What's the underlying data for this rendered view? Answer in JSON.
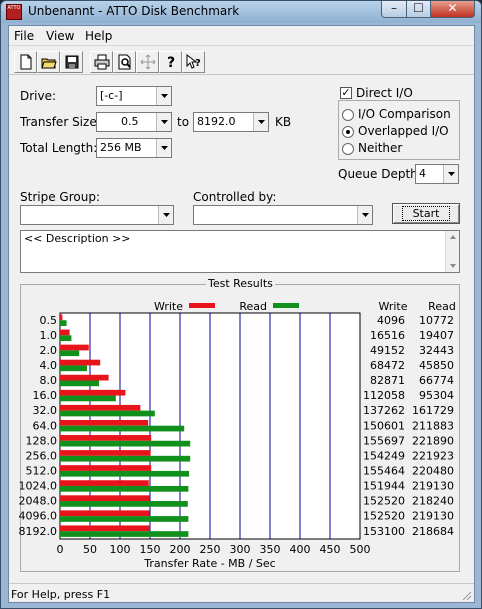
{
  "window": {
    "title": "Unbenannt - ATTO Disk Benchmark",
    "app_icon_text": "ATTO",
    "min": "–",
    "max": "☐",
    "close": "✕"
  },
  "menu": [
    "File",
    "View",
    "Help"
  ],
  "toolbar": [
    "new-icon",
    "open-icon",
    "save-icon",
    "print-icon",
    "print-preview-icon",
    "move-icon",
    "help-icon",
    "context-help-icon"
  ],
  "form": {
    "drive_label": "Drive:",
    "drive_value": "[-c-]",
    "transfer_label": "Transfer Size:",
    "transfer_from": "0.5",
    "to_label": "to",
    "transfer_to": "8192.0",
    "kb_label": "KB",
    "length_label": "Total Length:",
    "length_value": "256 MB",
    "direct_io_label": "Direct I/O",
    "direct_io_checked": true,
    "io_comparison_label": "I/O Comparison",
    "overlapped_io_label": "Overlapped I/O",
    "neither_label": "Neither",
    "selected_mode": "overlapped",
    "queue_label": "Queue Depth:",
    "queue_value": "4",
    "stripe_label": "Stripe Group:",
    "stripe_value": "",
    "controlled_label": "Controlled by:",
    "controlled_value": "",
    "start_label": "Start",
    "description": "<< Description >>"
  },
  "chart_data": {
    "type": "bar",
    "title": "Test Results",
    "xlabel": "Transfer Rate - MB / Sec",
    "ylabel": "",
    "xlim": [
      0,
      500
    ],
    "xticks": [
      0,
      50,
      100,
      150,
      200,
      250,
      300,
      350,
      400,
      450,
      500
    ],
    "grid": true,
    "legend": "top",
    "categories": [
      "0.5",
      "1.0",
      "2.0",
      "4.0",
      "8.0",
      "16.0",
      "32.0",
      "64.0",
      "128.0",
      "256.0",
      "512.0",
      "1024.0",
      "2048.0",
      "4096.0",
      "8192.0"
    ],
    "series": [
      {
        "name": "Write",
        "color": "#e8141c",
        "values": [
          4,
          16,
          48,
          67,
          81,
          109,
          134,
          147,
          152,
          151,
          152,
          148,
          149,
          149,
          150
        ]
      },
      {
        "name": "Read",
        "color": "#12901c",
        "values": [
          11,
          19,
          32,
          45,
          65,
          93,
          158,
          207,
          217,
          217,
          215,
          214,
          213,
          214,
          214
        ]
      }
    ],
    "table_headers": [
      "Write",
      "Read"
    ],
    "write_kb": [
      "4096",
      "16516",
      "49152",
      "68472",
      "82871",
      "112058",
      "137262",
      "150601",
      "155697",
      "154249",
      "155464",
      "151944",
      "152520",
      "152520",
      "153100"
    ],
    "read_kb": [
      "10772",
      "19407",
      "32443",
      "45850",
      "66774",
      "95304",
      "161729",
      "211883",
      "221890",
      "221923",
      "220480",
      "219130",
      "218240",
      "219130",
      "218684"
    ]
  },
  "status": "For Help, press F1"
}
